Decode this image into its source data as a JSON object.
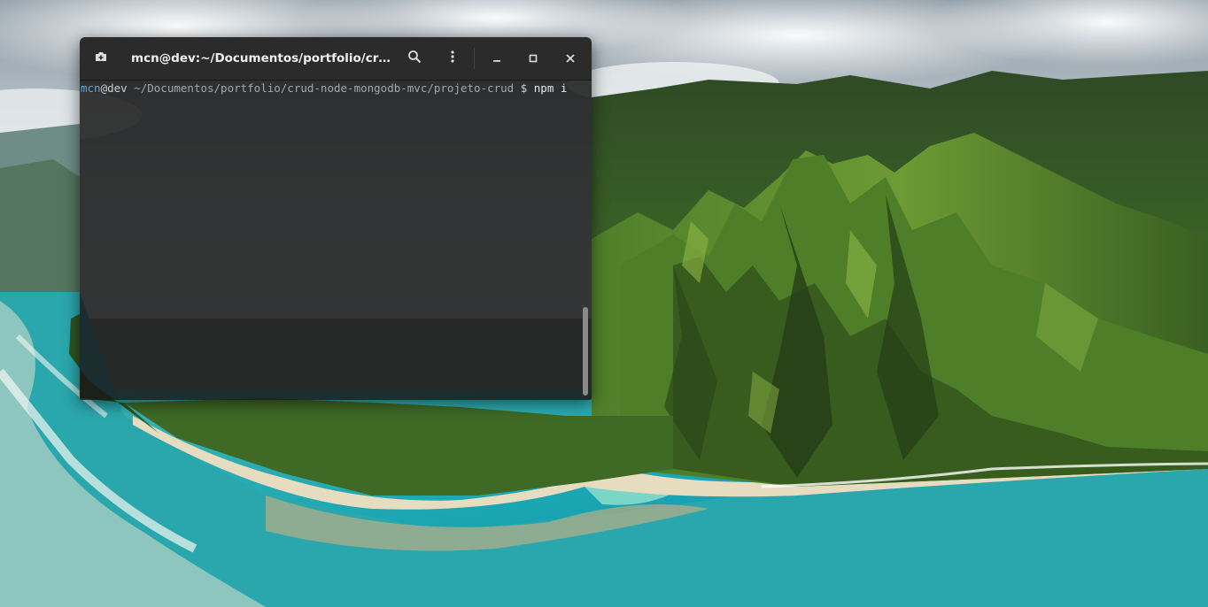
{
  "desktop": {
    "wallpaper": "aerial view of green mountain ridges meeting a turquoise coastline"
  },
  "terminal": {
    "title": "mcn@dev:~/Documentos/portfolio/crud-node…",
    "prompt": {
      "user": "mcn",
      "at": "@",
      "host": "dev",
      "path": "~/Documentos/portfolio/crud-node-mongodb-mvc/projeto-crud",
      "symbol": "$",
      "command": "npm i"
    },
    "icons": {
      "new_tab": "new-tab-icon",
      "search": "search-icon",
      "menu": "kebab-menu-icon",
      "minimize": "minimize-icon",
      "maximize": "maximize-icon",
      "close": "close-icon"
    },
    "colors": {
      "titlebar": "#2b2b2b",
      "user": "#5aa7e8",
      "text": "#cfcfcf"
    }
  }
}
